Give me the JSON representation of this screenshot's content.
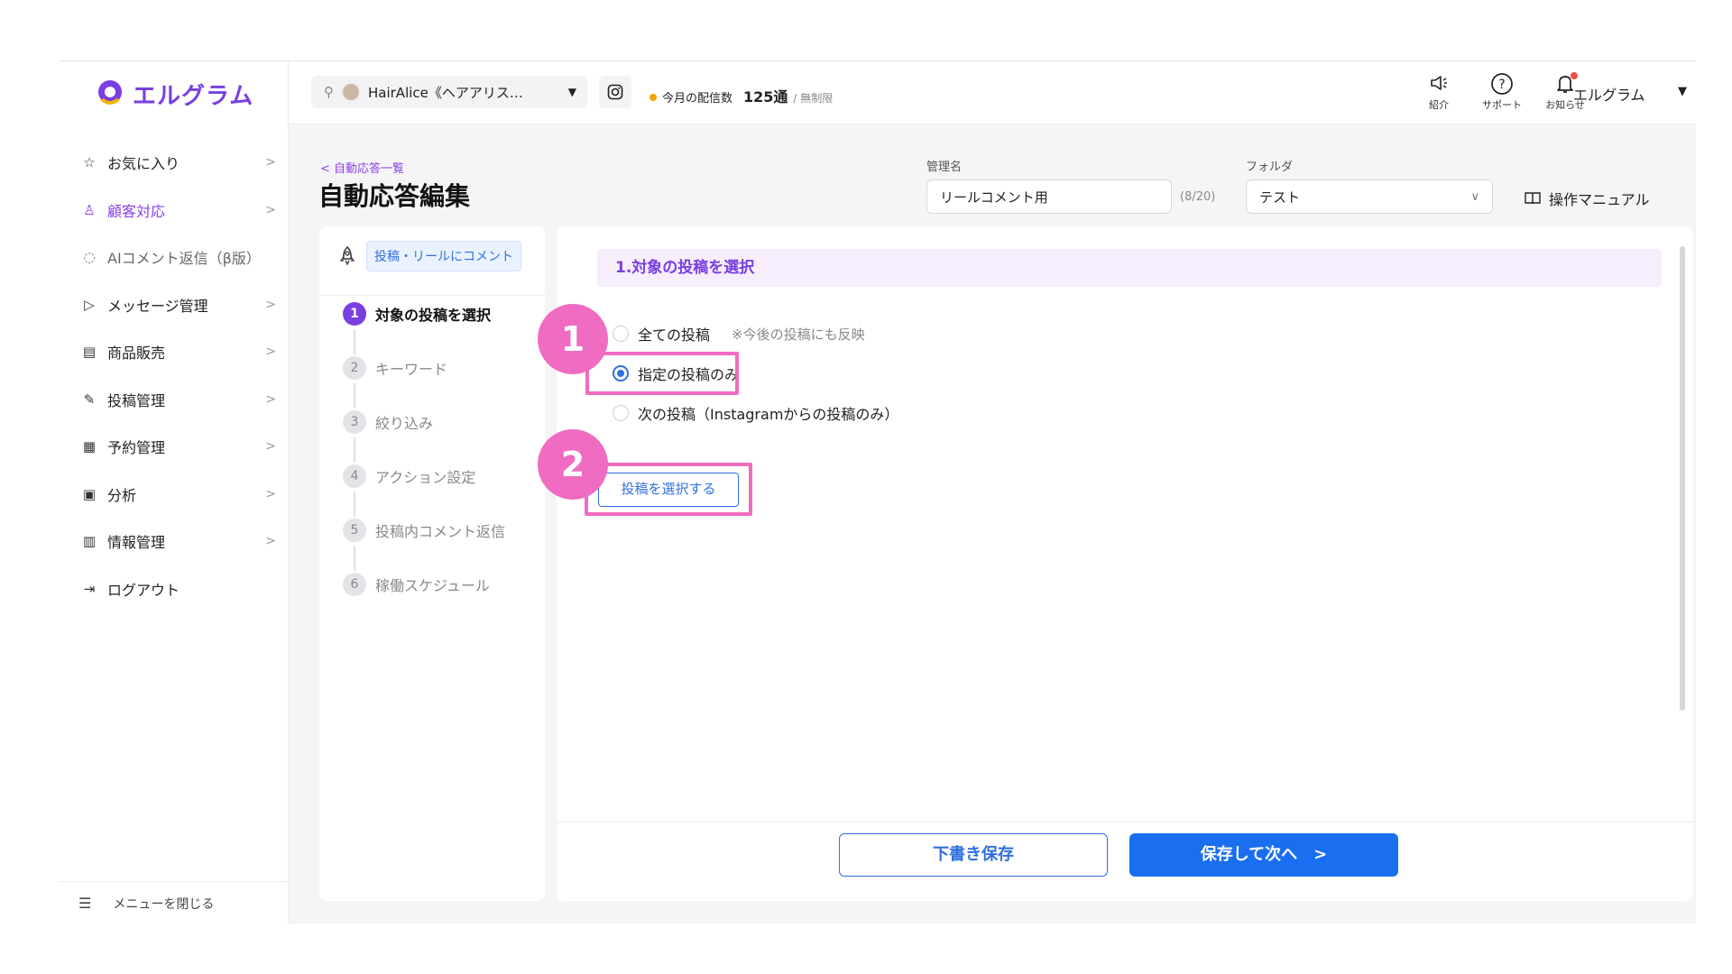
{
  "brand": {
    "name": "エルグラム",
    "accent": "#7a3fe0",
    "highlight": "#f06cc2",
    "primary": "#1a6ff0"
  },
  "sidebar": {
    "items": [
      {
        "label": "お気に入り",
        "icon": "star-icon",
        "glyph": "☆",
        "chevron": true
      },
      {
        "label": "顧客対応",
        "icon": "user-icon",
        "glyph": "♙",
        "chevron": true,
        "active": true
      },
      {
        "label": "AIコメント返信（β版）",
        "icon": "ai-chat-icon",
        "glyph": "◌",
        "chevron": false,
        "muted": true
      },
      {
        "label": "メッセージ管理",
        "icon": "send-icon",
        "glyph": "▷",
        "chevron": true
      },
      {
        "label": "商品販売",
        "icon": "shop-icon",
        "glyph": "▤",
        "chevron": true
      },
      {
        "label": "投稿管理",
        "icon": "edit-icon",
        "glyph": "✎",
        "chevron": true
      },
      {
        "label": "予約管理",
        "icon": "calendar-icon",
        "glyph": "▦",
        "chevron": true
      },
      {
        "label": "分析",
        "icon": "report-icon",
        "glyph": "▣",
        "chevron": true
      },
      {
        "label": "情報管理",
        "icon": "chart-icon",
        "glyph": "▥",
        "chevron": true
      },
      {
        "label": "ログアウト",
        "icon": "logout-icon",
        "glyph": "⇥",
        "chevron": false
      }
    ],
    "footer_label": "メニューを閉じる"
  },
  "topbar": {
    "account_name": "HairAlice《ヘアアリス…",
    "quota_label": "今月の配信数",
    "quota_value": "125通",
    "quota_limit": "/ 無制限",
    "icons": [
      {
        "label": "紹介",
        "icon": "megaphone-icon",
        "glyph": "◁"
      },
      {
        "label": "サポート",
        "icon": "help-icon",
        "glyph": "?"
      },
      {
        "label": "お知らせ",
        "icon": "bell-icon",
        "glyph": "♪"
      }
    ],
    "user_name": "エルグラム"
  },
  "header": {
    "back_link": "自動応答一覧",
    "title": "自動応答編集",
    "name_label": "管理名",
    "name_value": "リールコメント用",
    "name_counter": "(8/20)",
    "folder_label": "フォルダ",
    "folder_value": "テスト",
    "manual_label": "操作マニュアル"
  },
  "steps": {
    "trigger_label": "投稿・リールにコメント",
    "items": [
      {
        "num": "1",
        "label": "対象の投稿を選択",
        "active": true
      },
      {
        "num": "2",
        "label": "キーワード"
      },
      {
        "num": "3",
        "label": "絞り込み"
      },
      {
        "num": "4",
        "label": "アクション設定"
      },
      {
        "num": "5",
        "label": "投稿内コメント返信"
      },
      {
        "num": "6",
        "label": "稼働スケジュール"
      }
    ]
  },
  "main": {
    "section_title": "1.対象の投稿を選択",
    "options": [
      {
        "label": "全ての投稿",
        "note": "※今後の投稿にも反映",
        "selected": false
      },
      {
        "label": "指定の投稿のみ",
        "note": "",
        "selected": true
      },
      {
        "label": "次の投稿（Instagramからの投稿のみ）",
        "note": "",
        "selected": false
      }
    ],
    "select_posts_button": "投稿を選択する",
    "annotations": [
      "1",
      "2"
    ],
    "draft_button": "下書き保存",
    "next_button": "保存して次へ　>"
  }
}
